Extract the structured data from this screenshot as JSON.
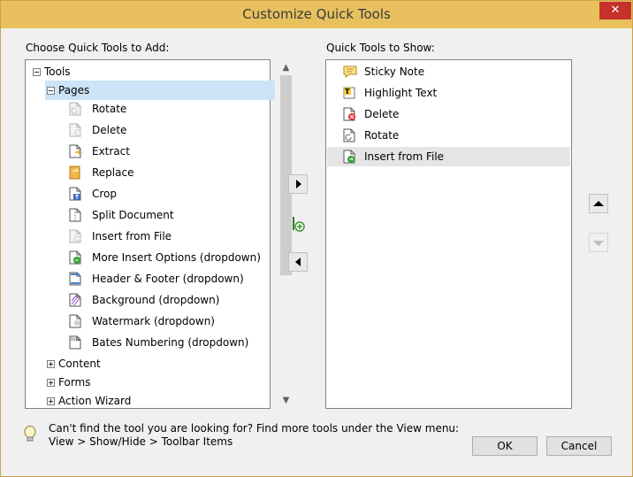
{
  "window": {
    "title": "Customize Quick Tools",
    "close_glyph": "✕"
  },
  "left": {
    "heading": "Choose Quick Tools to Add:",
    "tools_label": "Tools",
    "pages_label": "Pages",
    "items": [
      {
        "label": "Rotate",
        "icon": "rotate-page-icon",
        "disabled": true
      },
      {
        "label": "Delete",
        "icon": "delete-page-icon",
        "disabled": true
      },
      {
        "label": "Extract",
        "icon": "extract-page-icon",
        "disabled": false
      },
      {
        "label": "Replace",
        "icon": "replace-page-icon",
        "disabled": false
      },
      {
        "label": "Crop",
        "icon": "crop-page-icon",
        "disabled": false
      },
      {
        "label": "Split Document",
        "icon": "split-document-icon",
        "disabled": false
      },
      {
        "label": "Insert from File",
        "icon": "insert-from-file-icon",
        "disabled": true
      },
      {
        "label": "More Insert Options  (dropdown)",
        "icon": "more-insert-options-icon",
        "disabled": false
      },
      {
        "label": "Header & Footer  (dropdown)",
        "icon": "header-footer-icon",
        "disabled": false
      },
      {
        "label": "Background  (dropdown)",
        "icon": "background-icon",
        "disabled": false
      },
      {
        "label": "Watermark  (dropdown)",
        "icon": "watermark-icon",
        "disabled": false
      },
      {
        "label": "Bates Numbering  (dropdown)",
        "icon": "bates-numbering-icon",
        "disabled": false
      }
    ],
    "groups": [
      "Content",
      "Forms",
      "Action Wizard"
    ]
  },
  "right": {
    "heading": "Quick Tools to Show:",
    "items": [
      {
        "label": "Sticky Note",
        "icon": "sticky-note-icon"
      },
      {
        "label": "Highlight Text",
        "icon": "highlight-text-icon"
      },
      {
        "label": "Delete",
        "icon": "delete-page-icon"
      },
      {
        "label": "Rotate",
        "icon": "rotate-page-icon"
      },
      {
        "label": "Insert from File",
        "icon": "insert-from-file-icon"
      }
    ],
    "selected_index": 4
  },
  "hint": {
    "line1": "Can't find the tool you are looking for? Find more tools under the View menu:",
    "line2": "View > Show/Hide > Toolbar Items"
  },
  "buttons": {
    "ok": "OK",
    "cancel": "Cancel"
  },
  "colors": {
    "titlebar": "#e8c15e",
    "close": "#c7312b",
    "tree_selected": "#cce4f7",
    "list_selected": "#e5e5e5"
  }
}
